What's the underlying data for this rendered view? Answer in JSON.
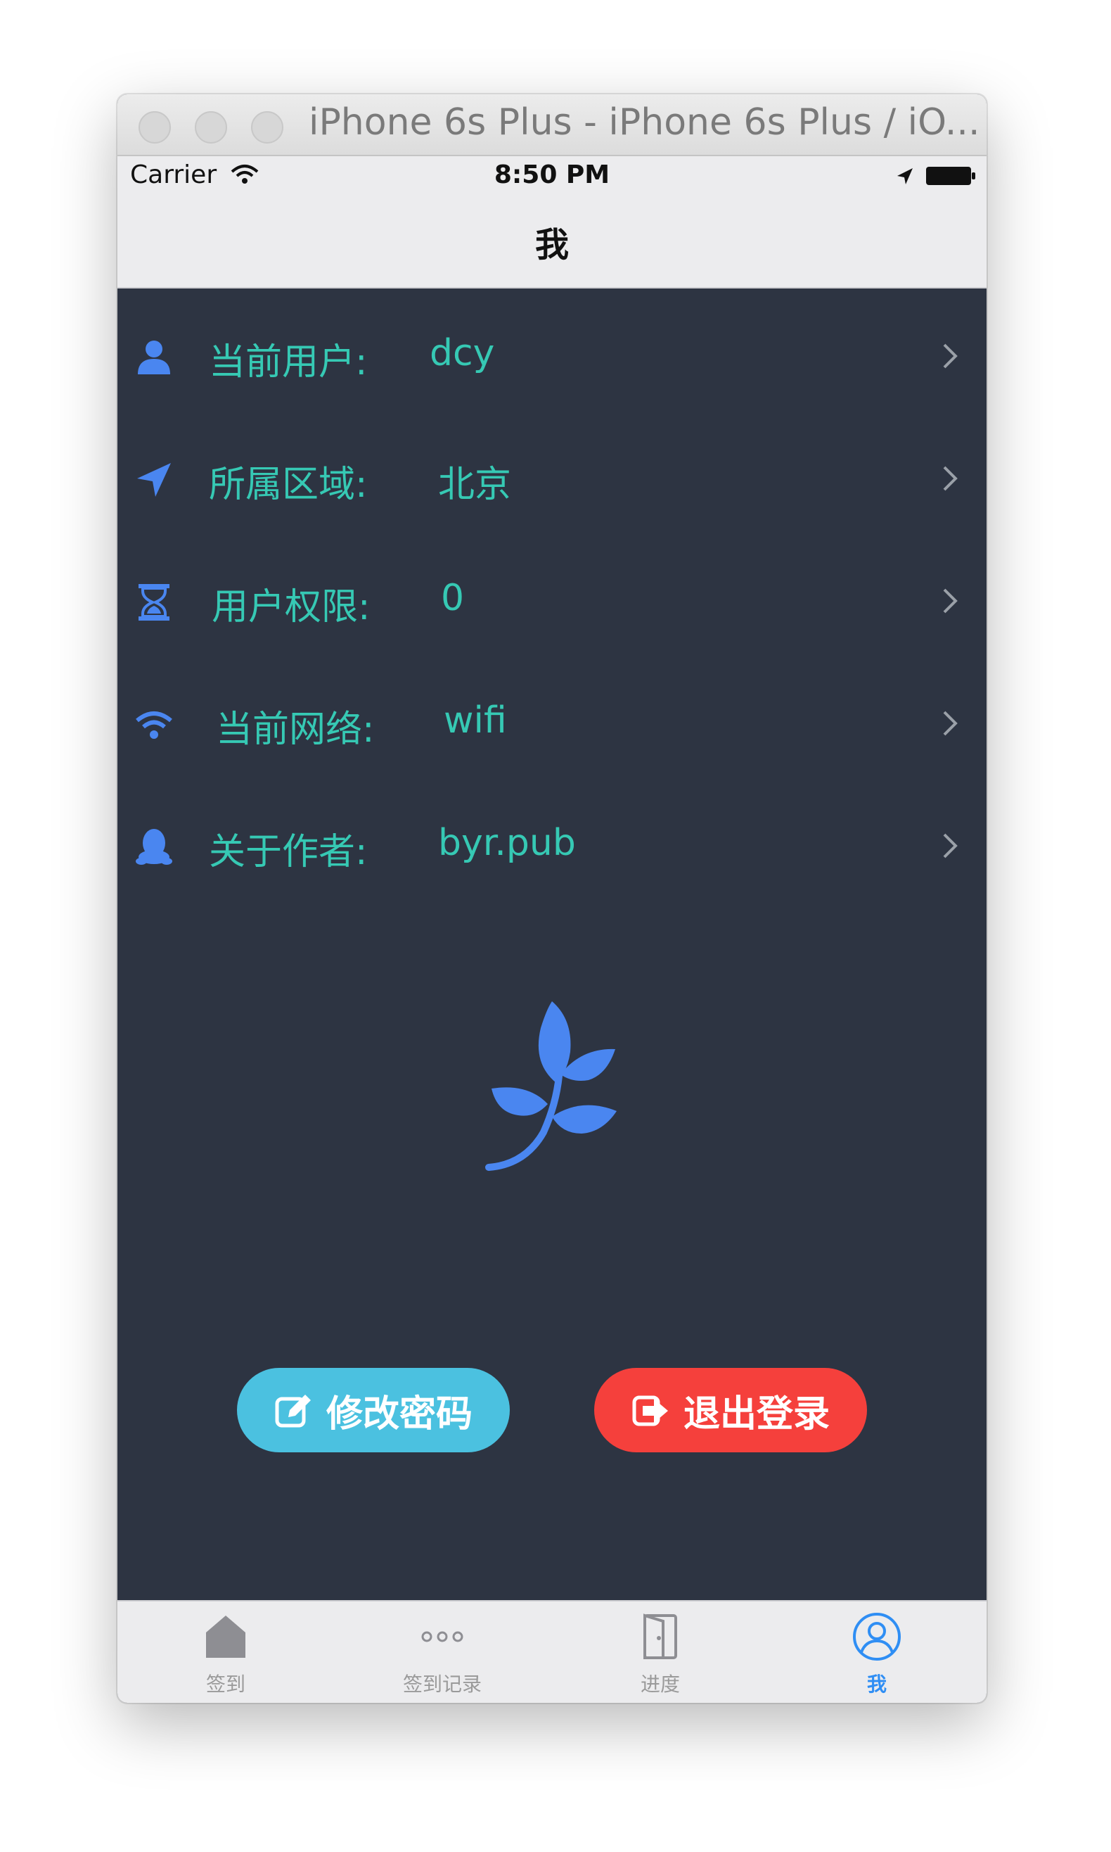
{
  "window": {
    "title": "iPhone 6s Plus - iPhone 6s Plus / iO..."
  },
  "status_bar": {
    "carrier": "Carrier",
    "time": "8:50 PM"
  },
  "nav": {
    "title": "我"
  },
  "rows": [
    {
      "label": "当前用户:",
      "value": "dcy",
      "icon": "user-icon"
    },
    {
      "label": "所属区域:",
      "value": "北京",
      "icon": "location-arrow-icon"
    },
    {
      "label": "用户权限:",
      "value": "0",
      "icon": "hourglass-icon"
    },
    {
      "label": "当前网络:",
      "value": "wifi",
      "icon": "wifi-icon"
    },
    {
      "label": "关于作者:",
      "value": "byr.pub",
      "icon": "qq-penguin-icon"
    }
  ],
  "buttons": {
    "change_password": "修改密码",
    "logout": "退出登录"
  },
  "tabs": [
    {
      "label": "签到",
      "icon": "home-icon",
      "active": false
    },
    {
      "label": "签到记录",
      "icon": "more-dots-icon",
      "active": false
    },
    {
      "label": "进度",
      "icon": "door-icon",
      "active": false
    },
    {
      "label": "我",
      "icon": "profile-icon",
      "active": true
    }
  ],
  "colors": {
    "background": "#2d3442",
    "accent_text": "#36c9b4",
    "icon_blue": "#4a86f0",
    "change_password_button": "#4bc1e0",
    "logout_button": "#f5403c",
    "active_tab": "#2f8ef4"
  }
}
